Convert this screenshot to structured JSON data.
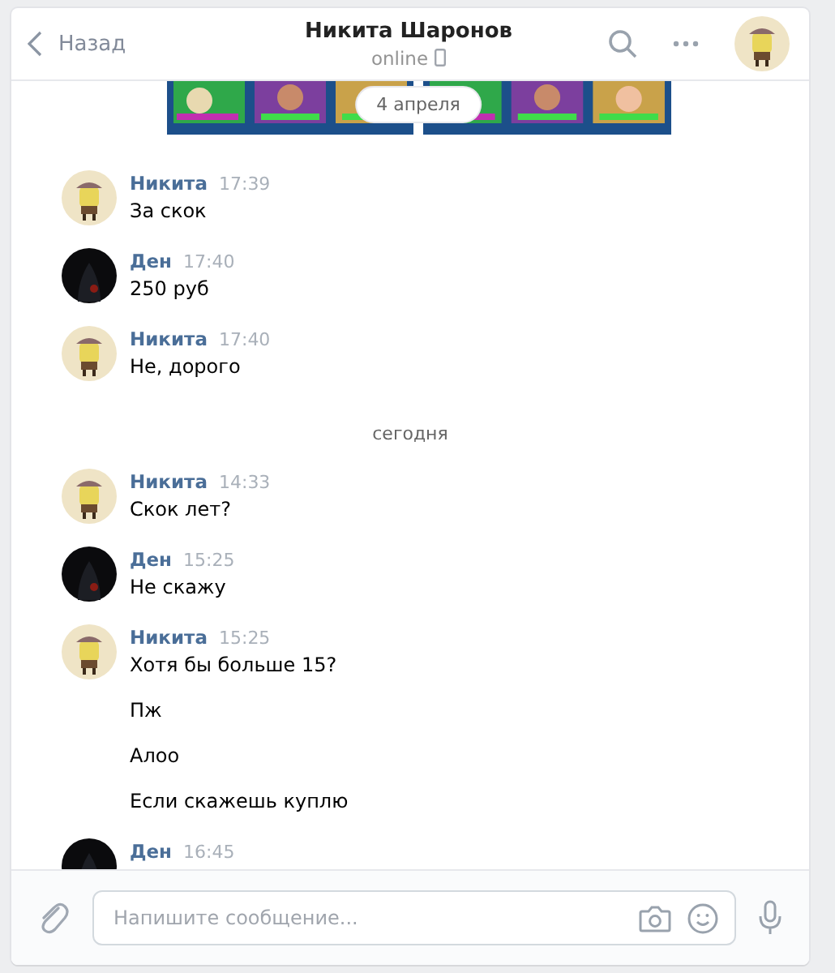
{
  "header": {
    "back_label": "Назад",
    "title": "Никита Шаронов",
    "status": "online"
  },
  "attachment": {
    "kind": "picture",
    "date": "4 апреля"
  },
  "timeline": [
    {
      "kind": "message",
      "author": "Никита",
      "time": "17:39",
      "color": "#efe4c6",
      "lines": [
        "За скок"
      ]
    },
    {
      "kind": "message",
      "author": "Ден",
      "time": "17:40",
      "color": "#0b0b0d",
      "lines": [
        "250 руб"
      ]
    },
    {
      "kind": "message",
      "author": "Никита",
      "time": "17:40",
      "color": "#efe4c6",
      "lines": [
        "Не, дорого"
      ]
    },
    {
      "kind": "date",
      "text": "сегодня"
    },
    {
      "kind": "message",
      "author": "Никита",
      "time": "14:33",
      "color": "#efe4c6",
      "lines": [
        "Скок лет?"
      ]
    },
    {
      "kind": "message",
      "author": "Ден",
      "time": "15:25",
      "color": "#0b0b0d",
      "lines": [
        "Не скажу"
      ]
    },
    {
      "kind": "message",
      "author": "Никита",
      "time": "15:25",
      "color": "#efe4c6",
      "lines": [
        "Хотя бы больше 15?",
        "Пж",
        "Алоо",
        "Если скажешь куплю"
      ]
    },
    {
      "kind": "message",
      "author": "Ден",
      "time": "16:45",
      "color": "#0b0b0d"
    }
  ],
  "composer": {
    "placeholder": "Напишите сообщение..."
  }
}
